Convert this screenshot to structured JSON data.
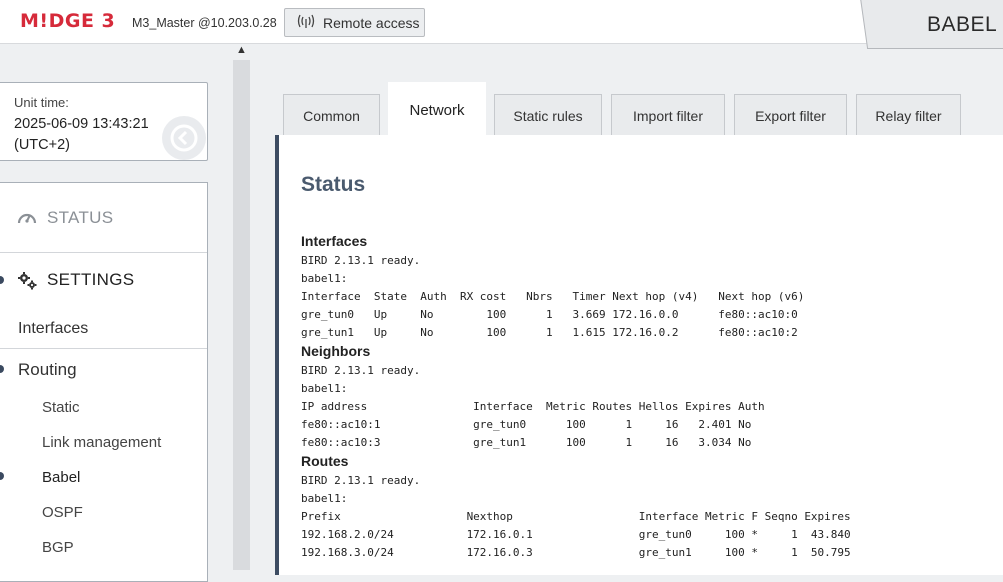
{
  "header": {
    "logo": "M!DGE 3",
    "connection": "M3_Master @10.203.0.28",
    "remote_access_label": "Remote access",
    "module_title": "BABEL"
  },
  "unit": {
    "label": "Unit time:",
    "time": "2025-06-09 13:43:21",
    "tz": "(UTC+2)"
  },
  "nav": {
    "status": "STATUS",
    "settings": "SETTINGS",
    "interfaces": "Interfaces",
    "routing": "Routing",
    "sub": [
      "Static",
      "Link management",
      "Babel",
      "OSPF",
      "BGP"
    ]
  },
  "tabs": [
    "Common",
    "Network",
    "Static rules",
    "Import filter",
    "Export filter",
    "Relay filter"
  ],
  "active_tab": "Network",
  "content": {
    "title": "Status",
    "sections": [
      {
        "heading": "Interfaces",
        "lines": [
          "BIRD 2.13.1 ready.",
          "babel1:",
          "Interface  State  Auth  RX cost   Nbrs   Timer Next hop (v4)   Next hop (v6)",
          "gre_tun0   Up     No        100      1   3.669 172.16.0.0      fe80::ac10:0",
          "gre_tun1   Up     No        100      1   1.615 172.16.0.2      fe80::ac10:2"
        ]
      },
      {
        "heading": "Neighbors",
        "lines": [
          "BIRD 2.13.1 ready.",
          "babel1:",
          "IP address                Interface  Metric Routes Hellos Expires Auth",
          "fe80::ac10:1              gre_tun0      100      1     16   2.401 No",
          "fe80::ac10:3              gre_tun1      100      1     16   3.034 No"
        ]
      },
      {
        "heading": "Routes",
        "lines": [
          "BIRD 2.13.1 ready.",
          "babel1:",
          "Prefix                   Nexthop                   Interface Metric F Seqno Expires",
          "192.168.2.0/24           172.16.0.1                gre_tun0     100 *     1  43.840",
          "192.168.3.0/24           172.16.0.3                gre_tun1     100 *     1  50.795"
        ]
      }
    ]
  }
}
